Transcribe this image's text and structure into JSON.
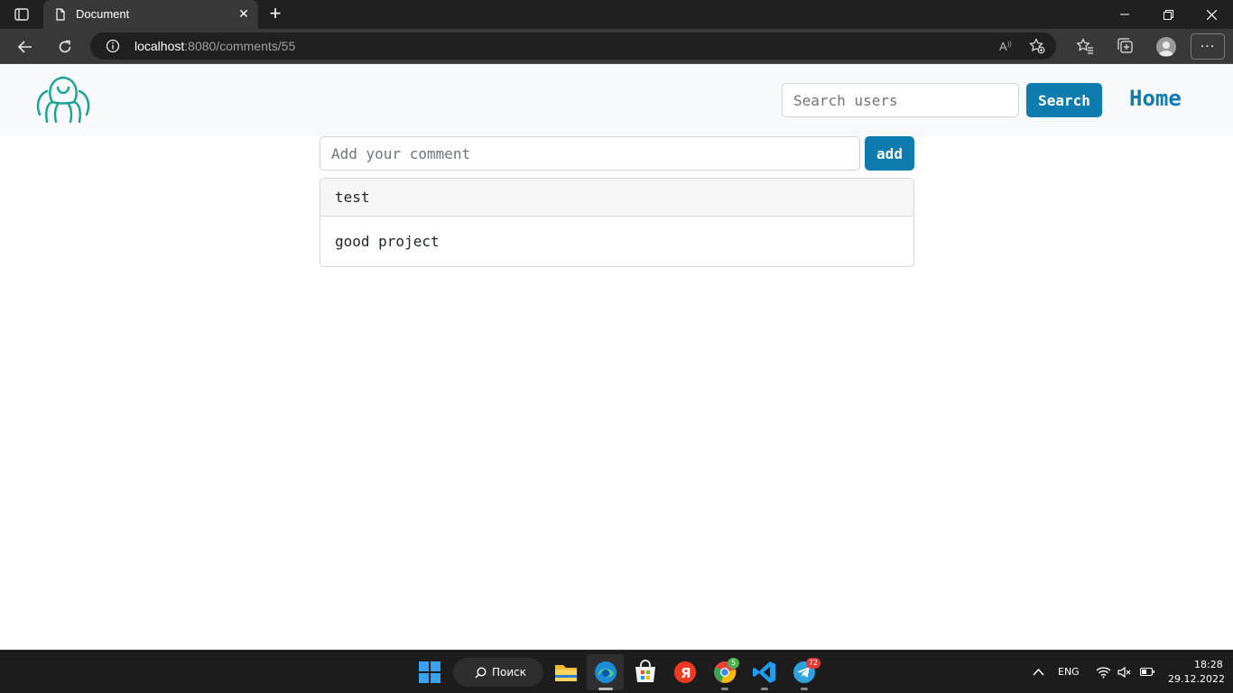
{
  "browser": {
    "tab_title": "Document",
    "url_host": "localhost",
    "url_rest": ":8080/comments/55"
  },
  "header": {
    "search_placeholder": "Search users",
    "search_button": "Search",
    "home_link": "Home"
  },
  "comment_form": {
    "placeholder": "Add your comment",
    "add_button": "add"
  },
  "comments": [
    {
      "author": "test",
      "text": "good project"
    }
  ],
  "taskbar": {
    "search_label": "Поиск",
    "chrome_badge": "5",
    "telegram_badge": "72",
    "language": "ENG",
    "time": "18:28",
    "date": "29.12.2022"
  },
  "colors": {
    "accent": "#0f7cb0",
    "logo": "#16a394"
  }
}
